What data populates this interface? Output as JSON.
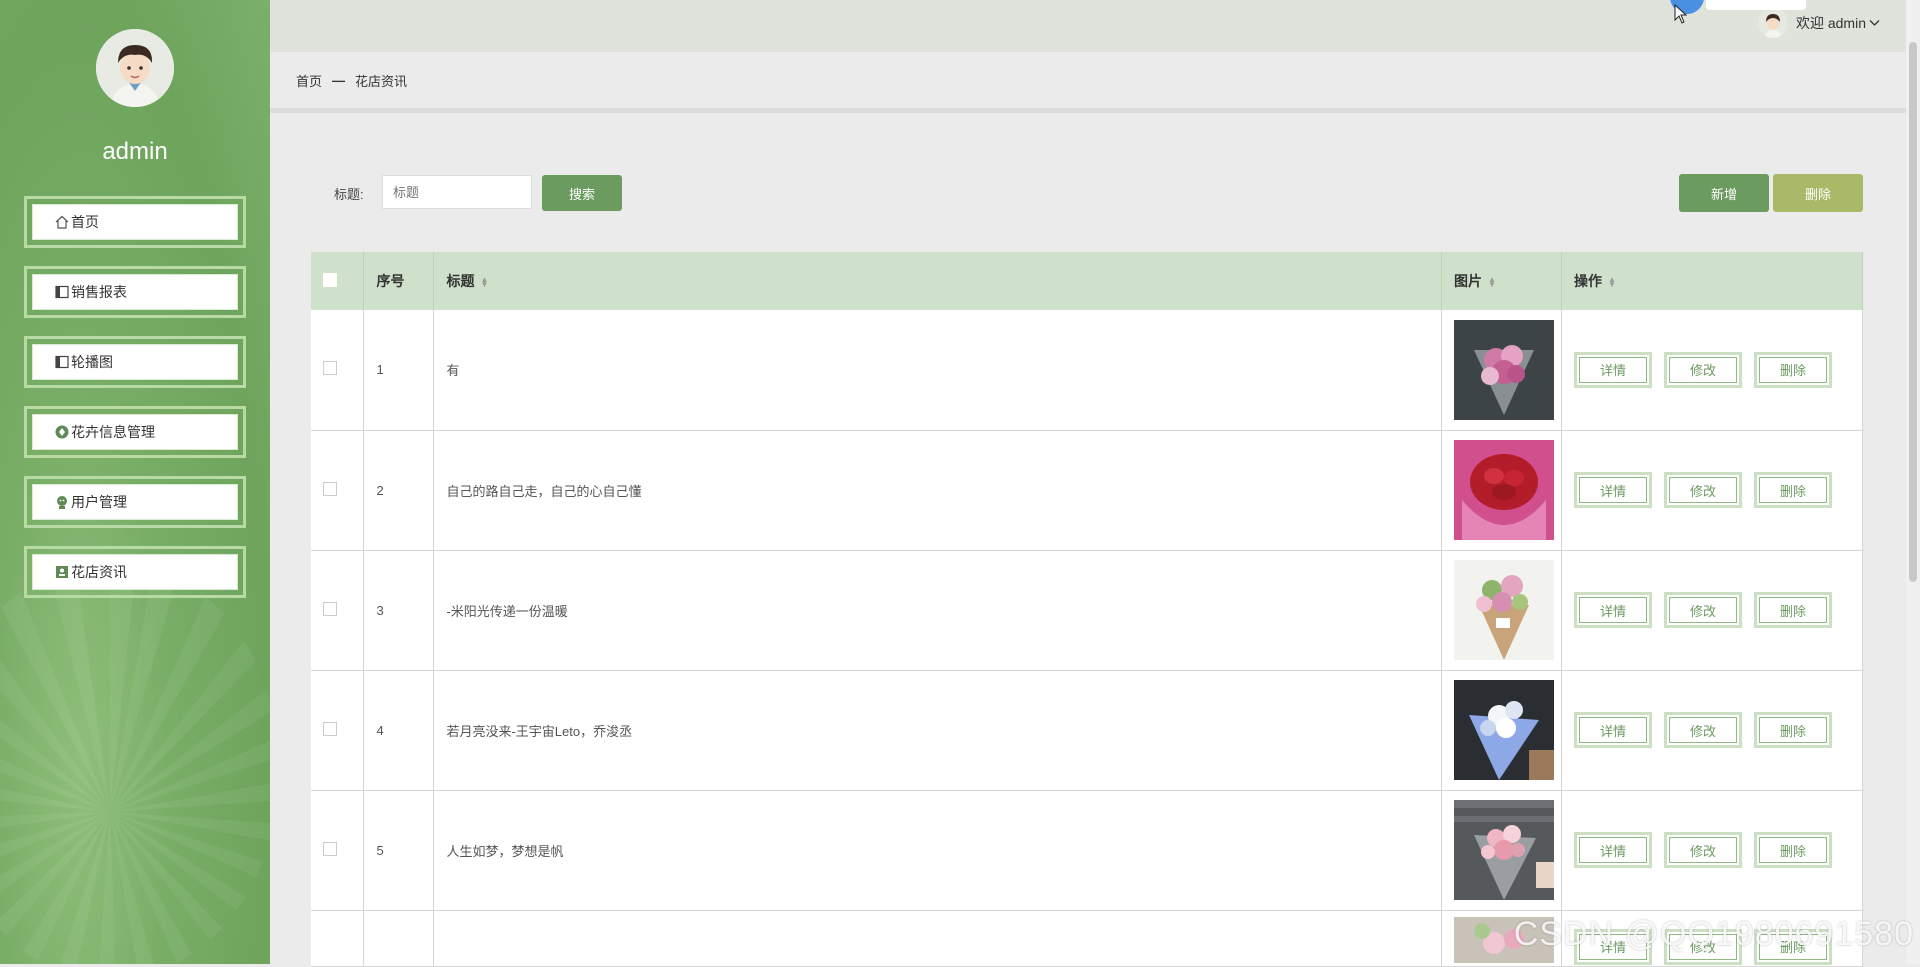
{
  "sidebar": {
    "username": "admin",
    "items": [
      {
        "label": "首页",
        "icon": "home-icon"
      },
      {
        "label": "销售报表",
        "icon": "panel-icon"
      },
      {
        "label": "轮播图",
        "icon": "panel-icon"
      },
      {
        "label": "花卉信息管理",
        "icon": "flower-icon"
      },
      {
        "label": "用户管理",
        "icon": "user-icon"
      },
      {
        "label": "花店资讯",
        "icon": "contact-icon"
      }
    ]
  },
  "topbar": {
    "welcome": "欢迎 admin"
  },
  "breadcrumb": {
    "home": "首页",
    "separator": "—",
    "current": "花店资讯"
  },
  "search": {
    "label": "标题:",
    "placeholder": "标题",
    "button": "搜索"
  },
  "actions": {
    "add": "新增",
    "delete": "删除"
  },
  "table": {
    "headers": {
      "index": "序号",
      "title": "标题",
      "image": "图片",
      "ops": "操作"
    },
    "op_labels": {
      "detail": "详情",
      "edit": "修改",
      "delete": "删除"
    },
    "rows": [
      {
        "index": "1",
        "title": "有",
        "image": "pink-bouquet"
      },
      {
        "index": "2",
        "title": "自己的路自己走，自己的心自己懂",
        "image": "red-roses"
      },
      {
        "index": "3",
        "title": "-米阳光传递一份温暖",
        "image": "kraft-bouquet"
      },
      {
        "index": "4",
        "title": "若月亮没来-王宇宙Leto，乔浚丞",
        "image": "blue-bouquet"
      },
      {
        "index": "5",
        "title": "人生如梦，梦想是帆",
        "image": "grey-bouquet"
      },
      {
        "index": "",
        "title": "",
        "image": "partial-bouquet"
      }
    ]
  },
  "watermark": "CSDN @QQ1980691580",
  "colors": {
    "accent": "#6c9b60",
    "delete": "#a8ba68",
    "sidebar": "#78ad66",
    "header_row": "#cfe1ca"
  }
}
